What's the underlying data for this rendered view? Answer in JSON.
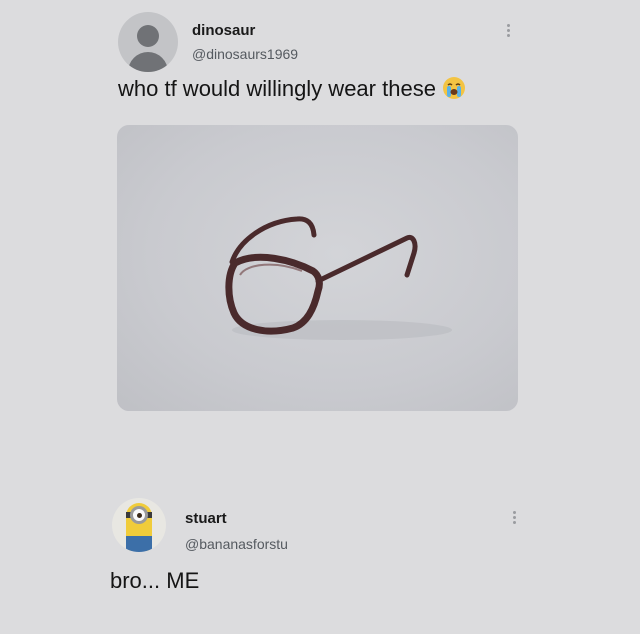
{
  "posts": [
    {
      "display_name": "dinosaur",
      "handle": "@dinosaurs1969",
      "text": "who tf would willingly wear these",
      "emoji": "loudly-crying-face-icon",
      "media": "glasses-photo"
    },
    {
      "display_name": "stuart",
      "handle": "@bananasforstu",
      "text": "bro... ME"
    }
  ],
  "colors": {
    "background": "#dcdcde",
    "media_background": "#c9cacf",
    "glasses_frame": "#4a2a2c"
  }
}
